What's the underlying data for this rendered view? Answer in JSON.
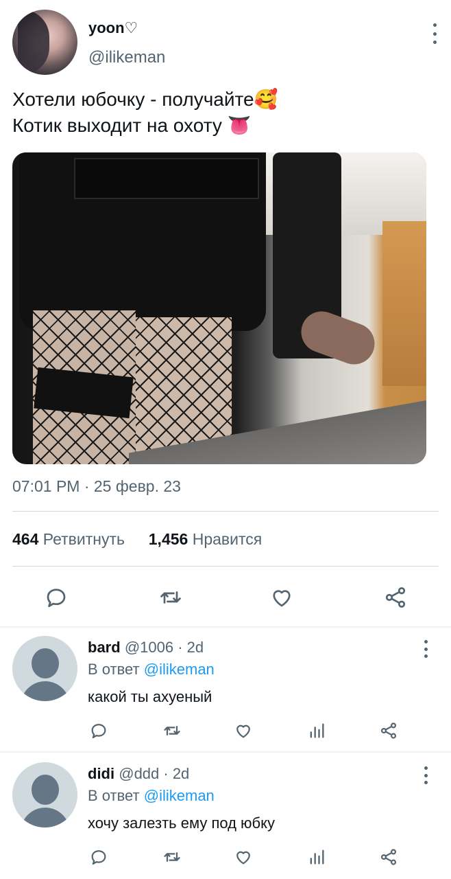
{
  "tweet": {
    "display_name": "yoon♡",
    "handle": "@ilikeman",
    "text_line1": "Хотели юбочку - получайте🥰",
    "text_line2": "Котик выходит на охоту 👅",
    "timestamp": "07:01 PM · 25 февр. 23",
    "retweets_count": "464",
    "retweets_label": "Ретвитнуть",
    "likes_count": "1,456",
    "likes_label": "Нравится"
  },
  "replies": [
    {
      "name": "bard",
      "meta": "@1006 · 2d",
      "reply_prefix": "В ответ",
      "reply_to": "@ilikeman",
      "text": "какой ты ахуеный"
    },
    {
      "name": "didi",
      "meta": "@ddd · 2d",
      "reply_prefix": "В ответ",
      "reply_to": "@ilikeman",
      "text": "хочу залезть ему под юбку"
    }
  ],
  "colors": {
    "text": "#0f1419",
    "secondary": "#536471",
    "link": "#1d9bf0",
    "divider": "#cfd9de"
  },
  "icons": [
    "more-icon",
    "reply-icon",
    "retweet-icon",
    "like-icon",
    "share-icon",
    "analytics-icon"
  ]
}
